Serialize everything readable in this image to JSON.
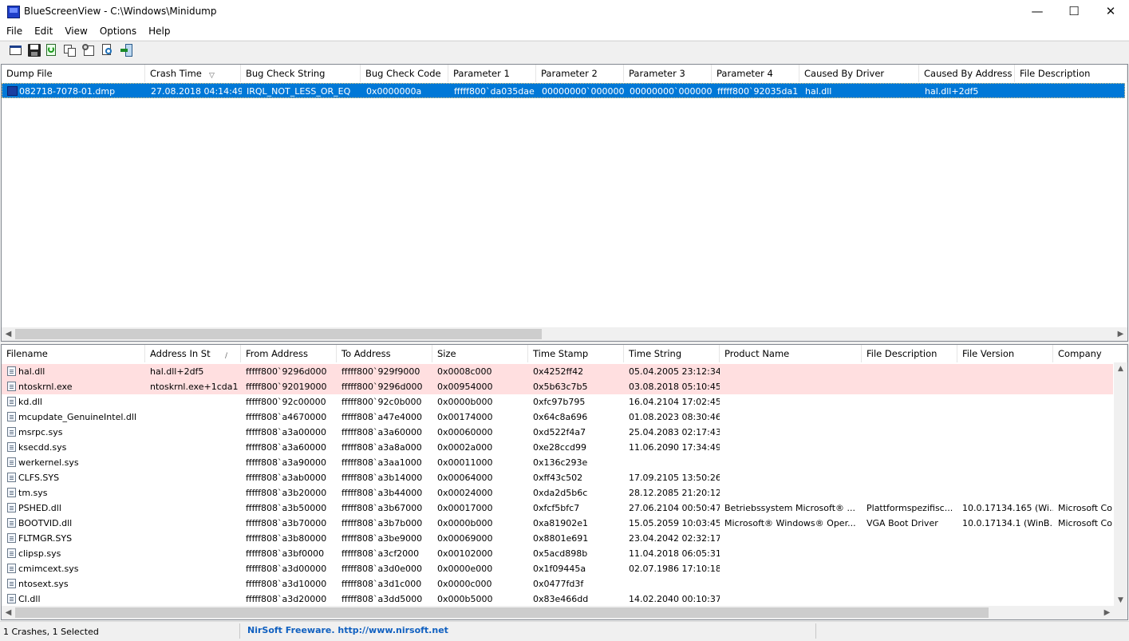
{
  "window": {
    "title": "BlueScreenView  -  C:\\Windows\\Minidump",
    "minimize": "—",
    "maximize": "☐",
    "close": "✕"
  },
  "menu": [
    "File",
    "Edit",
    "View",
    "Options",
    "Help"
  ],
  "toolbar": {
    "icons": [
      "html-report-icon",
      "save-icon",
      "refresh-icon",
      "copy-icon",
      "properties-icon",
      "find-icon",
      "exit-icon"
    ]
  },
  "crash_list": {
    "columns": [
      "Dump File",
      "Crash Time",
      "Bug Check String",
      "Bug Check Code",
      "Parameter 1",
      "Parameter 2",
      "Parameter 3",
      "Parameter 4",
      "Caused By Driver",
      "Caused By Address",
      "File Description"
    ],
    "sort_indicator": "▽",
    "rows": [
      [
        "082718-7078-01.dmp",
        "27.08.2018 04:14:49",
        "IRQL_NOT_LESS_OR_EQ",
        "0x0000000a",
        "fffff800`da035dae",
        "00000000`000000",
        "00000000`000000",
        "fffff800`92035da1",
        "hal.dll",
        "hal.dll+2df5",
        ""
      ]
    ]
  },
  "driver_list": {
    "columns": [
      "Filename",
      "Address In St",
      "From Address",
      "To Address",
      "Size",
      "Time Stamp",
      "Time String",
      "Product Name",
      "File Description",
      "File Version",
      "Company"
    ],
    "sort_indicator": "∕",
    "rows": [
      [
        "hal.dll",
        "hal.dll+2df5",
        "fffff800`9296d000",
        "fffff800`929f9000",
        "0x0008c000",
        "0x4252ff42",
        "05.04.2005 23:12:34",
        "",
        "",
        "",
        ""
      ],
      [
        "ntoskrnl.exe",
        "ntoskrnl.exe+1cda1",
        "fffff800`92019000",
        "fffff800`9296d000",
        "0x00954000",
        "0x5b63c7b5",
        "03.08.2018 05:10:45",
        "",
        "",
        "",
        ""
      ],
      [
        "kd.dll",
        "",
        "fffff800`92c00000",
        "fffff800`92c0b000",
        "0x0000b000",
        "0xfc97b795",
        "16.04.2104 17:02:45",
        "",
        "",
        "",
        ""
      ],
      [
        "mcupdate_GenuineIntel.dll",
        "",
        "fffff808`a4670000",
        "fffff808`a47e4000",
        "0x00174000",
        "0x64c8a696",
        "01.08.2023 08:30:46",
        "",
        "",
        "",
        ""
      ],
      [
        "msrpc.sys",
        "",
        "fffff808`a3a00000",
        "fffff808`a3a60000",
        "0x00060000",
        "0xd522f4a7",
        "25.04.2083 02:17:43",
        "",
        "",
        "",
        ""
      ],
      [
        "ksecdd.sys",
        "",
        "fffff808`a3a60000",
        "fffff808`a3a8a000",
        "0x0002a000",
        "0xe28ccd99",
        "11.06.2090 17:34:49",
        "",
        "",
        "",
        ""
      ],
      [
        "werkernel.sys",
        "",
        "fffff808`a3a90000",
        "fffff808`a3aa1000",
        "0x00011000",
        "0x136c293e",
        "",
        "",
        "",
        "",
        ""
      ],
      [
        "CLFS.SYS",
        "",
        "fffff808`a3ab0000",
        "fffff808`a3b14000",
        "0x00064000",
        "0xff43c502",
        "17.09.2105 13:50:26",
        "",
        "",
        "",
        ""
      ],
      [
        "tm.sys",
        "",
        "fffff808`a3b20000",
        "fffff808`a3b44000",
        "0x00024000",
        "0xda2d5b6c",
        "28.12.2085 21:20:12",
        "",
        "",
        "",
        ""
      ],
      [
        "PSHED.dll",
        "",
        "fffff808`a3b50000",
        "fffff808`a3b67000",
        "0x00017000",
        "0xfcf5bfc7",
        "27.06.2104 00:50:47",
        "Betriebssystem Microsoft® ...",
        "Plattformspezifisc...",
        "10.0.17134.165 (Wi...",
        "Microsoft Co"
      ],
      [
        "BOOTVID.dll",
        "",
        "fffff808`a3b70000",
        "fffff808`a3b7b000",
        "0x0000b000",
        "0xa81902e1",
        "15.05.2059 10:03:45",
        "Microsoft® Windows® Oper...",
        "VGA Boot Driver",
        "10.0.17134.1 (WinB...",
        "Microsoft Co"
      ],
      [
        "FLTMGR.SYS",
        "",
        "fffff808`a3b80000",
        "fffff808`a3be9000",
        "0x00069000",
        "0x8801e691",
        "23.04.2042 02:32:17",
        "",
        "",
        "",
        ""
      ],
      [
        "clipsp.sys",
        "",
        "fffff808`a3bf0000",
        "fffff808`a3cf2000",
        "0x00102000",
        "0x5acd898b",
        "11.04.2018 06:05:31",
        "",
        "",
        "",
        ""
      ],
      [
        "cmimcext.sys",
        "",
        "fffff808`a3d00000",
        "fffff808`a3d0e000",
        "0x0000e000",
        "0x1f09445a",
        "02.07.1986 17:10:18",
        "",
        "",
        "",
        ""
      ],
      [
        "ntosext.sys",
        "",
        "fffff808`a3d10000",
        "fffff808`a3d1c000",
        "0x0000c000",
        "0x0477fd3f",
        "",
        "",
        "",
        "",
        ""
      ],
      [
        "CI.dll",
        "",
        "fffff808`a3d20000",
        "fffff808`a3dd5000",
        "0x000b5000",
        "0x83e466dd",
        "14.02.2040 00:10:37",
        "",
        "",
        "",
        ""
      ]
    ]
  },
  "status": {
    "count": "1 Crashes, 1 Selected",
    "link": "NirSoft Freeware.  http://www.nirsoft.net"
  },
  "colors": {
    "selection": "#0078d7",
    "highlight_row": "#ffdfe0",
    "link": "#1060c0"
  }
}
